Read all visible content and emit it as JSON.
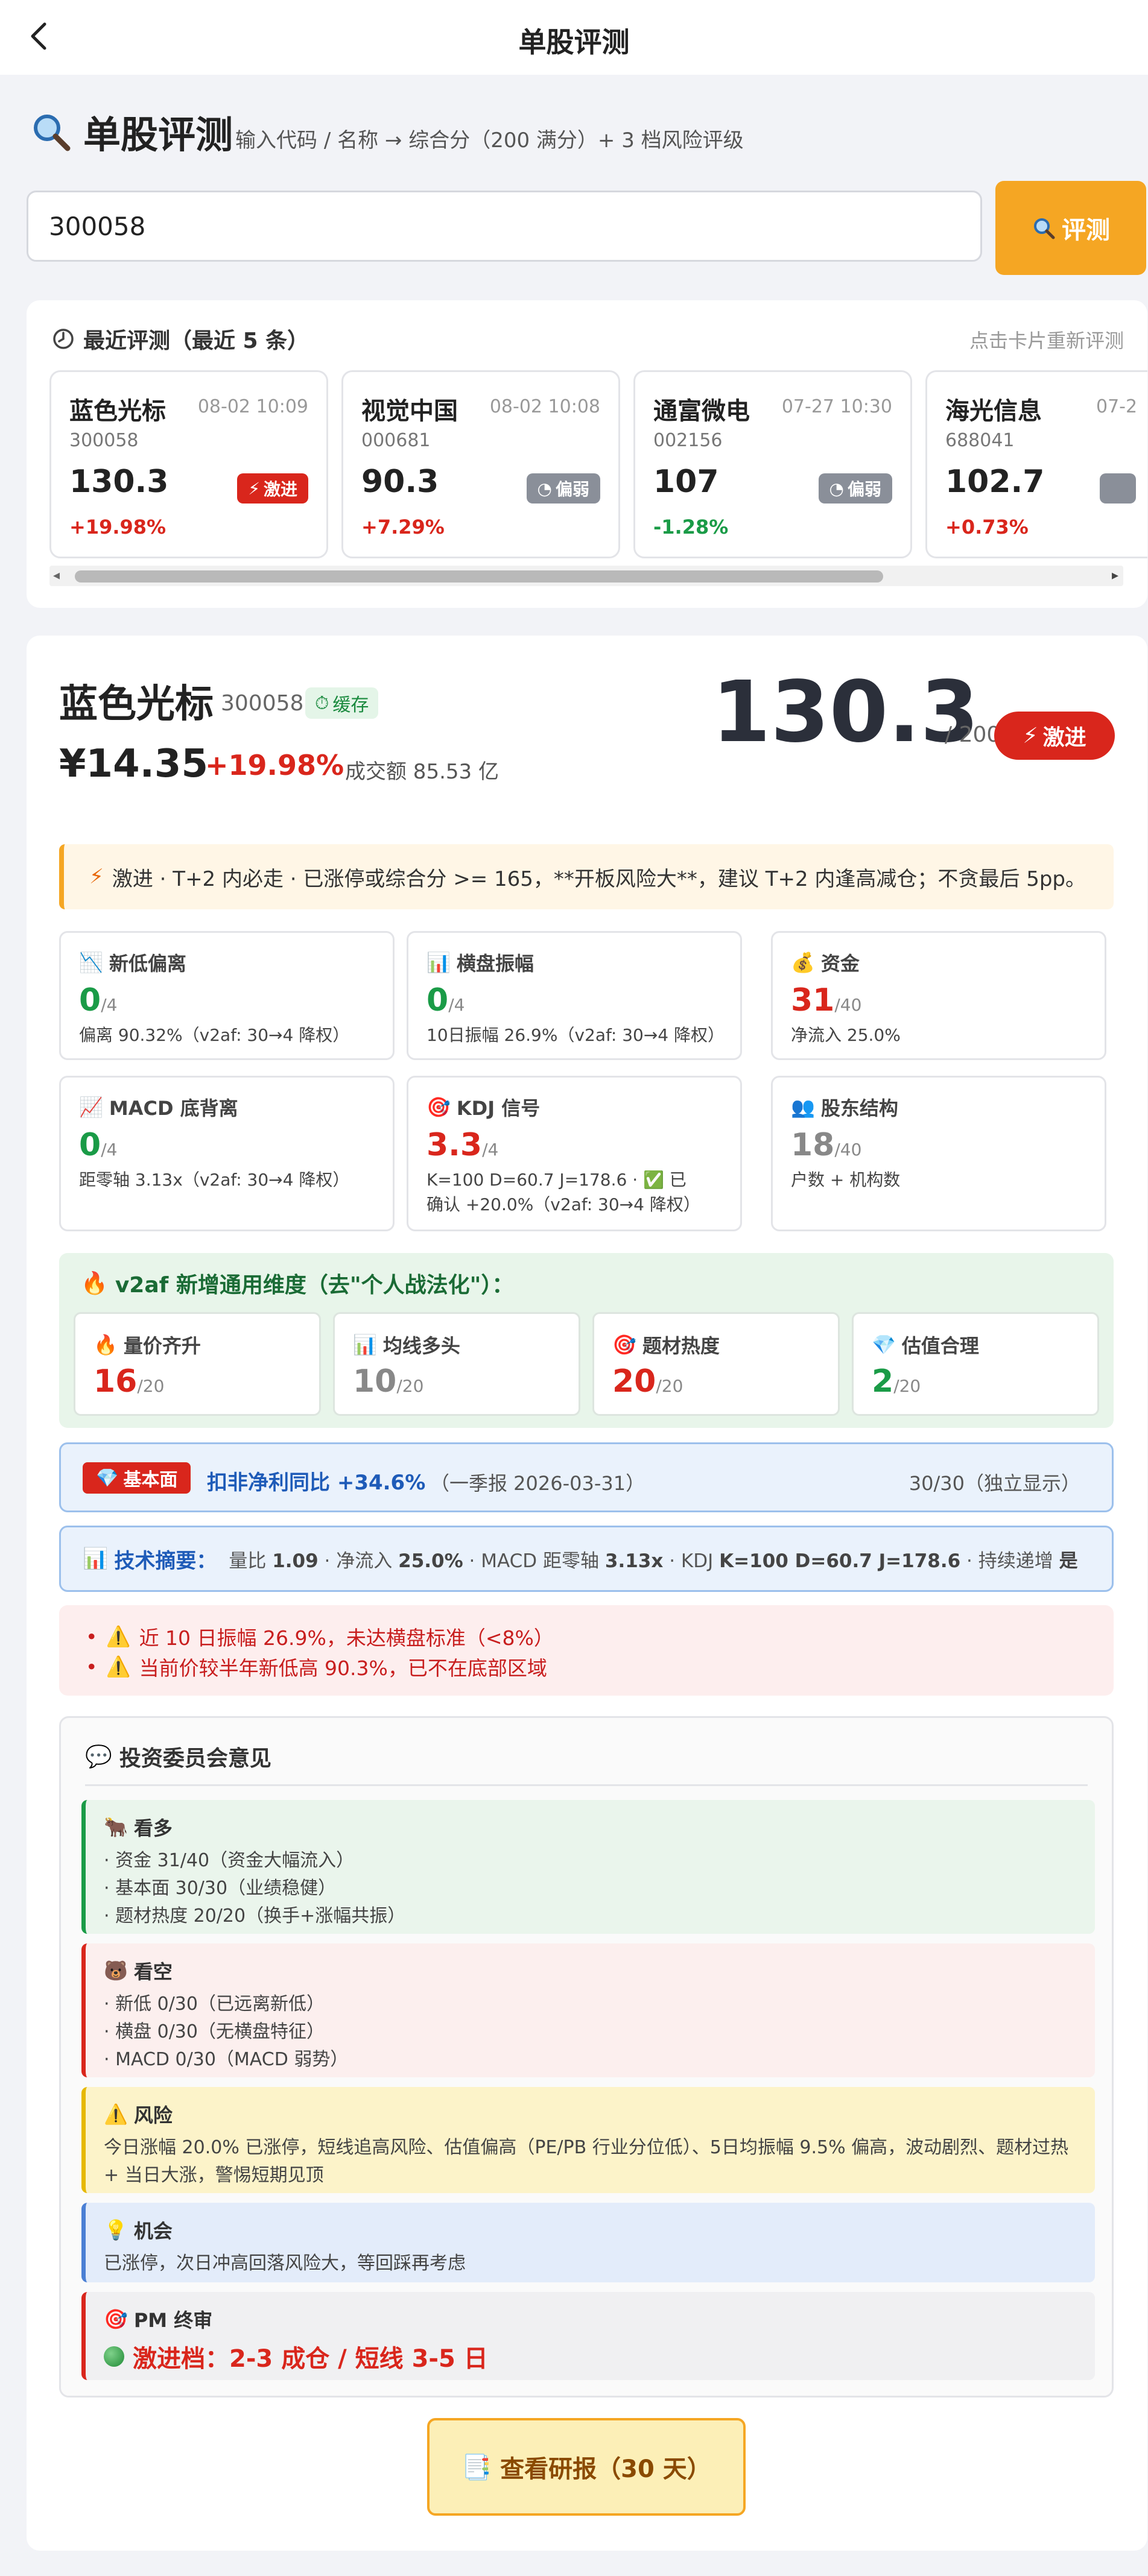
{
  "nav": {
    "title": "单股评测"
  },
  "header": {
    "title": "单股评测",
    "subtitle": "输入代码 / 名称 → 综合分（200 满分）+ 3 档风险评级"
  },
  "search": {
    "value": "300058",
    "button_label": "评测"
  },
  "recent": {
    "title": "最近评测（最近 5 条）",
    "hint": "点击卡片重新评测",
    "items": [
      {
        "name": "蓝色光标",
        "time": "08-02 10:09",
        "code": "300058",
        "score": "130.3",
        "change": "+19.98%",
        "tag": "激进"
      },
      {
        "name": "视觉中国",
        "time": "08-02 10:08",
        "code": "000681",
        "score": "90.3",
        "change": "+7.29%",
        "tag": "偏弱"
      },
      {
        "name": "通富微电",
        "time": "07-27 10:30",
        "code": "002156",
        "score": "107",
        "change": "-1.28%",
        "tag": "偏弱"
      },
      {
        "name": "海光信息",
        "time": "07-2",
        "code": "688041",
        "score": "102.7",
        "change": "+0.73%",
        "tag": ""
      }
    ]
  },
  "stock": {
    "name": "蓝色光标",
    "code": "300058",
    "cache_label": "缓存",
    "price": "¥14.35",
    "change": "+19.98%",
    "volume": "成交额 85.53 亿",
    "score": "130.3",
    "score_max": "/ 200",
    "rating": "激进"
  },
  "alert": {
    "text": "激进 · T+2 内必走 · 已涨停或综合分 >= 165，**开板风险大**，建议 T+2 内逢高减仓；不贪最后 5pp。"
  },
  "metrics": [
    {
      "title": "新低偏离",
      "value": "0",
      "max": "/4",
      "desc": "偏离 90.32%（v2af: 30→4 降权）",
      "icon": "chart-down-icon"
    },
    {
      "title": "横盘振幅",
      "value": "0",
      "max": "/4",
      "desc": "10日振幅 26.9%（v2af: 30→4 降权）",
      "icon": "bar-chart-icon"
    },
    {
      "title": "资金",
      "value": "31",
      "max": "/40",
      "desc": "净流入 25.0%",
      "icon": "money-bag-icon"
    },
    {
      "title": "MACD 底背离",
      "value": "0",
      "max": "/4",
      "desc": "距零轴 3.13x（v2af: 30→4 降权）",
      "icon": "chart-up-icon"
    },
    {
      "title": "KDJ 信号",
      "value": "3.3",
      "max": "/4",
      "desc": "K=100 D=60.7 J=178.6 · ✅ 已确认 +20.0%（v2af: 30→4 降权）",
      "icon": "target-icon"
    },
    {
      "title": "股东结构",
      "value": "18",
      "max": "/40",
      "desc": "户数 + 机构数",
      "icon": "people-icon"
    }
  ],
  "v2af": {
    "title": "v2af 新增通用维度（去\"个人战法化\"）：",
    "items": [
      {
        "title": "量价齐升",
        "value": "16",
        "max": "/20",
        "icon": "fire-icon"
      },
      {
        "title": "均线多头",
        "value": "10",
        "max": "/20",
        "icon": "bar-chart-icon"
      },
      {
        "title": "题材热度",
        "value": "20",
        "max": "/20",
        "icon": "target-icon"
      },
      {
        "title": "估值合理",
        "value": "2",
        "max": "/20",
        "icon": "diamond-icon"
      }
    ]
  },
  "fundamental": {
    "tag": "基本面",
    "text": "扣非净利同比 +34.6%",
    "date": "（一季报 2026-03-31）",
    "score": "30/30（独立显示）"
  },
  "tech": {
    "title": "技术摘要：",
    "items": [
      {
        "label": "量比",
        "value": "1.09"
      },
      {
        "label": "净流入",
        "value": "25.0%"
      },
      {
        "label": "MACD 距零轴",
        "value": "3.13x"
      },
      {
        "label": "KDJ",
        "value": "K=100 D=60.7 J=178.6"
      },
      {
        "label": "持续递增",
        "value": "是"
      }
    ]
  },
  "warnings": [
    "近 10 日振幅 26.9%，未达横盘标准（<8%）",
    "当前价较半年新低高 90.3%，已不在底部区域"
  ],
  "committee": {
    "title": "投资委员会意见",
    "bull": {
      "title": "看多",
      "lines": [
        "资金 31/40（资金大幅流入）",
        "基本面 30/30（业绩稳健）",
        "题材热度 20/20（换手+涨幅共振）"
      ]
    },
    "bear": {
      "title": "看空",
      "lines": [
        "新低 0/30（已远离新低）",
        "横盘 0/30（无横盘特征）",
        "MACD 0/30（MACD 弱势）"
      ]
    },
    "risk": {
      "title": "风险",
      "text": "今日涨幅 20.0% 已涨停，短线追高风险、估值偏高（PE/PB 行业分位低）、5日均振幅 9.5% 偏高，波动剧烈、题材过热 + 当日大涨，警惕短期见顶"
    },
    "opportunity": {
      "title": "机会",
      "text": "已涨停，次日冲高回落风险大，等回踩再考虑"
    },
    "pm": {
      "title": "PM 终审",
      "text": "激进档：2-3 成仓 / 短线 3-5 日"
    }
  },
  "report_button": {
    "label": "查看研报（30 天）"
  },
  "colors": {
    "accent": "#f5a623",
    "up": "#d9261c",
    "down": "#1a9b47",
    "weak_tag": "#8a8f99"
  }
}
